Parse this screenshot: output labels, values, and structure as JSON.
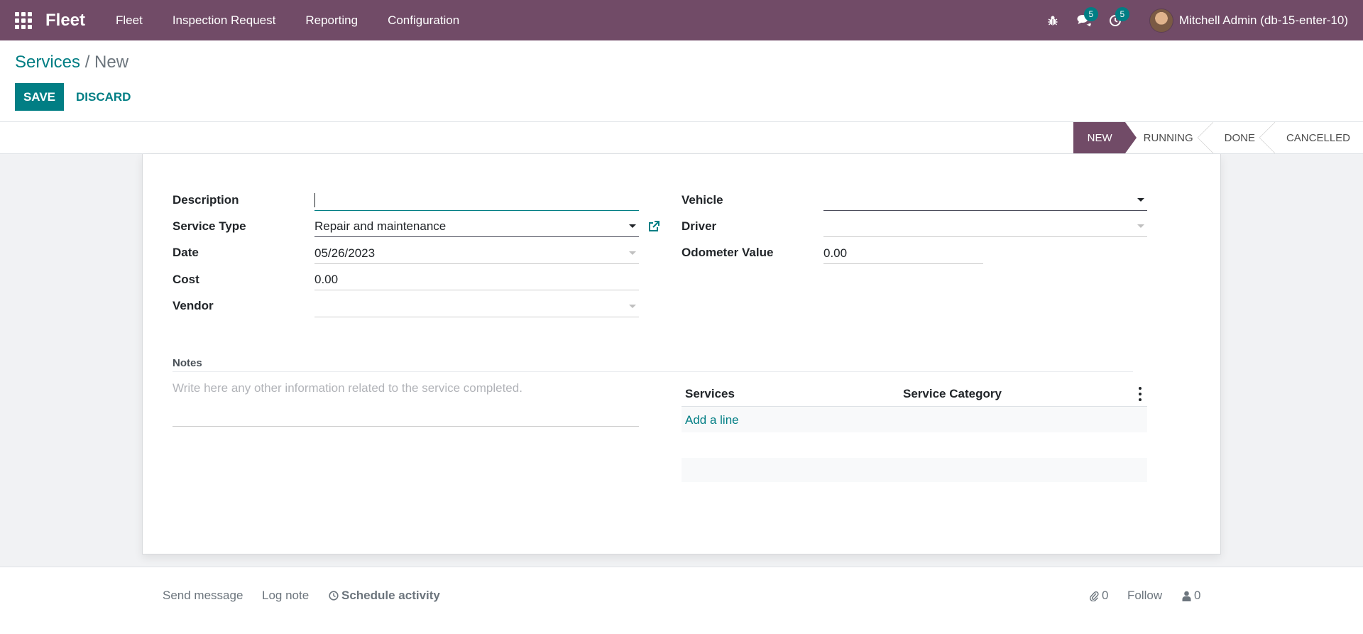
{
  "nav": {
    "brand": "Fleet",
    "menu": [
      "Fleet",
      "Inspection Request",
      "Reporting",
      "Configuration"
    ],
    "messages_count": "5",
    "activities_count": "5",
    "user": "Mitchell Admin (db-15-enter-10)"
  },
  "breadcrumb": {
    "parent": "Services",
    "separator": "/",
    "current": "New"
  },
  "buttons": {
    "save": "SAVE",
    "discard": "DISCARD"
  },
  "stages": [
    "NEW",
    "RUNNING",
    "DONE",
    "CANCELLED"
  ],
  "form": {
    "left": [
      {
        "label": "Description",
        "value": ""
      },
      {
        "label": "Service Type",
        "value": "Repair and maintenance"
      },
      {
        "label": "Date",
        "value": "05/26/2023"
      },
      {
        "label": "Cost",
        "value": "0.00"
      },
      {
        "label": "Vendor",
        "value": ""
      }
    ],
    "right": [
      {
        "label": "Vehicle",
        "value": ""
      },
      {
        "label": "Driver",
        "value": ""
      },
      {
        "label": "Odometer Value",
        "value": "0.00"
      }
    ]
  },
  "notes": {
    "label": "Notes",
    "placeholder": "Write here any other information related to the service completed."
  },
  "table": {
    "columns": [
      "Services",
      "Service Category"
    ],
    "add_line": "Add a line"
  },
  "chatter": {
    "send_message": "Send message",
    "log_note": "Log note",
    "schedule_activity": "Schedule activity",
    "attachments": "0",
    "follow": "Follow",
    "followers": "0"
  },
  "colors": {
    "brand": "#714B67",
    "accent": "#017e84"
  }
}
